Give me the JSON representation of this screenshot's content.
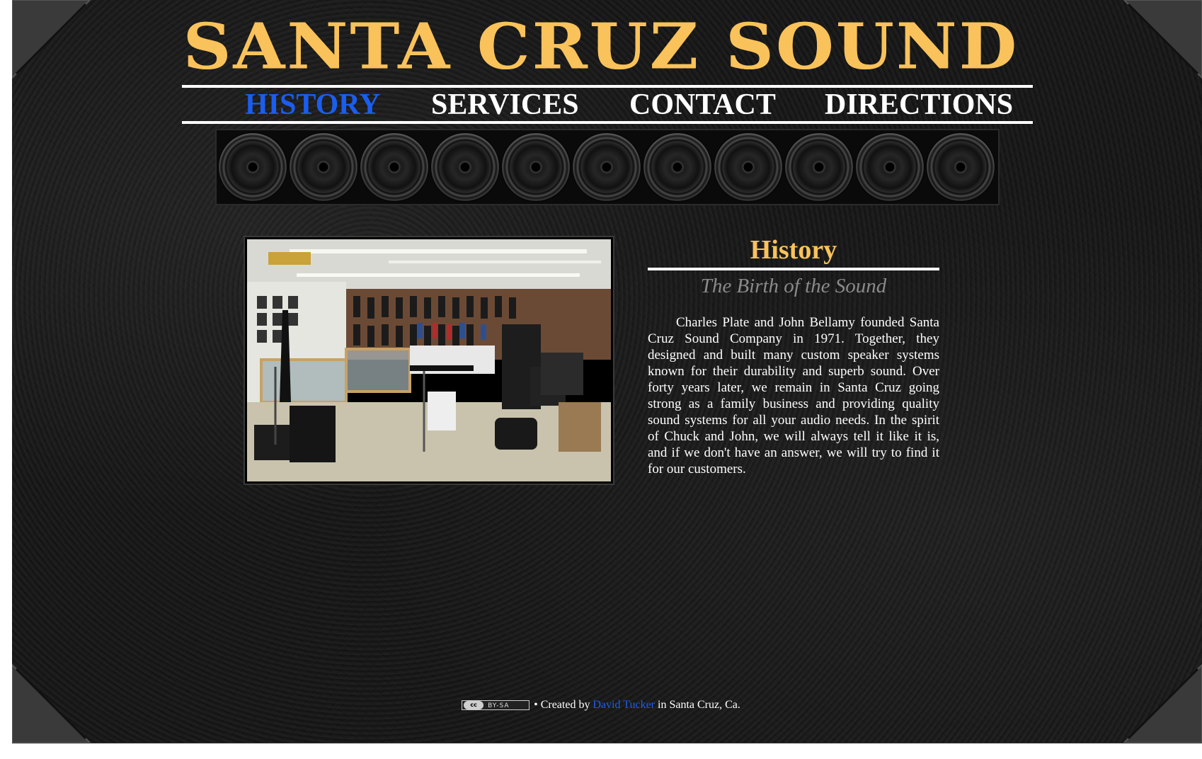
{
  "site": {
    "title": "SANTA CRUZ SOUND"
  },
  "nav": {
    "items": [
      {
        "label": "HISTORY",
        "active": true
      },
      {
        "label": "SERVICES",
        "active": false
      },
      {
        "label": "CONTACT",
        "active": false
      },
      {
        "label": "DIRECTIONS",
        "active": false
      }
    ]
  },
  "article": {
    "heading": "History",
    "subheading": "The Birth of the Sound",
    "body": "Charles Plate and John Bellamy founded Santa Cruz Sound Company in 1971. Together, they designed and built many custom speaker systems known for their durability and superb sound. Over forty years later, we remain in Santa Cruz going strong as a family business and providing quality sound systems for all your audio needs. In the spirit of Chuck and John, we will always tell it like it is, and if we don't have an answer, we will try to find it for our customers."
  },
  "footer": {
    "license_badge": "cc BY-SA",
    "license_badge_cc": "cc",
    "license_badge_text": "BY-SA",
    "prefix": "• Created by",
    "author": "David Tucker",
    "suffix": "in Santa Cruz, Ca."
  },
  "colors": {
    "accent_gold": "#f9c25a",
    "link_blue": "#1a5ef0",
    "background": "#171717",
    "subheading_gray": "#8a8a8a"
  },
  "speaker_count": 11
}
